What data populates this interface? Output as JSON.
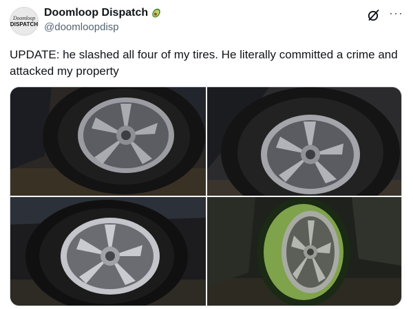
{
  "author": {
    "avatar_line1": "Doomloop",
    "avatar_line2": "DISPATCH",
    "display_name": "Doomloop Dispatch",
    "handle": "@doomloopdisp",
    "badge_icon": "avocado-icon"
  },
  "actions": {
    "grok_icon": "grok-icon",
    "more_icon": "more-options-icon",
    "more_glyph": "···"
  },
  "tweet": {
    "text": "UPDATE: he slashed all four of my tires. He literally committed a crime and attacked my property"
  },
  "media": {
    "count": 4,
    "photos": [
      {
        "subject": "flat front tire with silver alloy wheel"
      },
      {
        "subject": "tire sidewall and silver alloy wheel"
      },
      {
        "subject": "flat tire with silver alloy wheel at night"
      },
      {
        "subject": "tire with silver alloy wheel under green-tinted light"
      }
    ]
  },
  "colors": {
    "text": "#0f1419",
    "secondary": "#536471",
    "border": "#cfd9de"
  }
}
